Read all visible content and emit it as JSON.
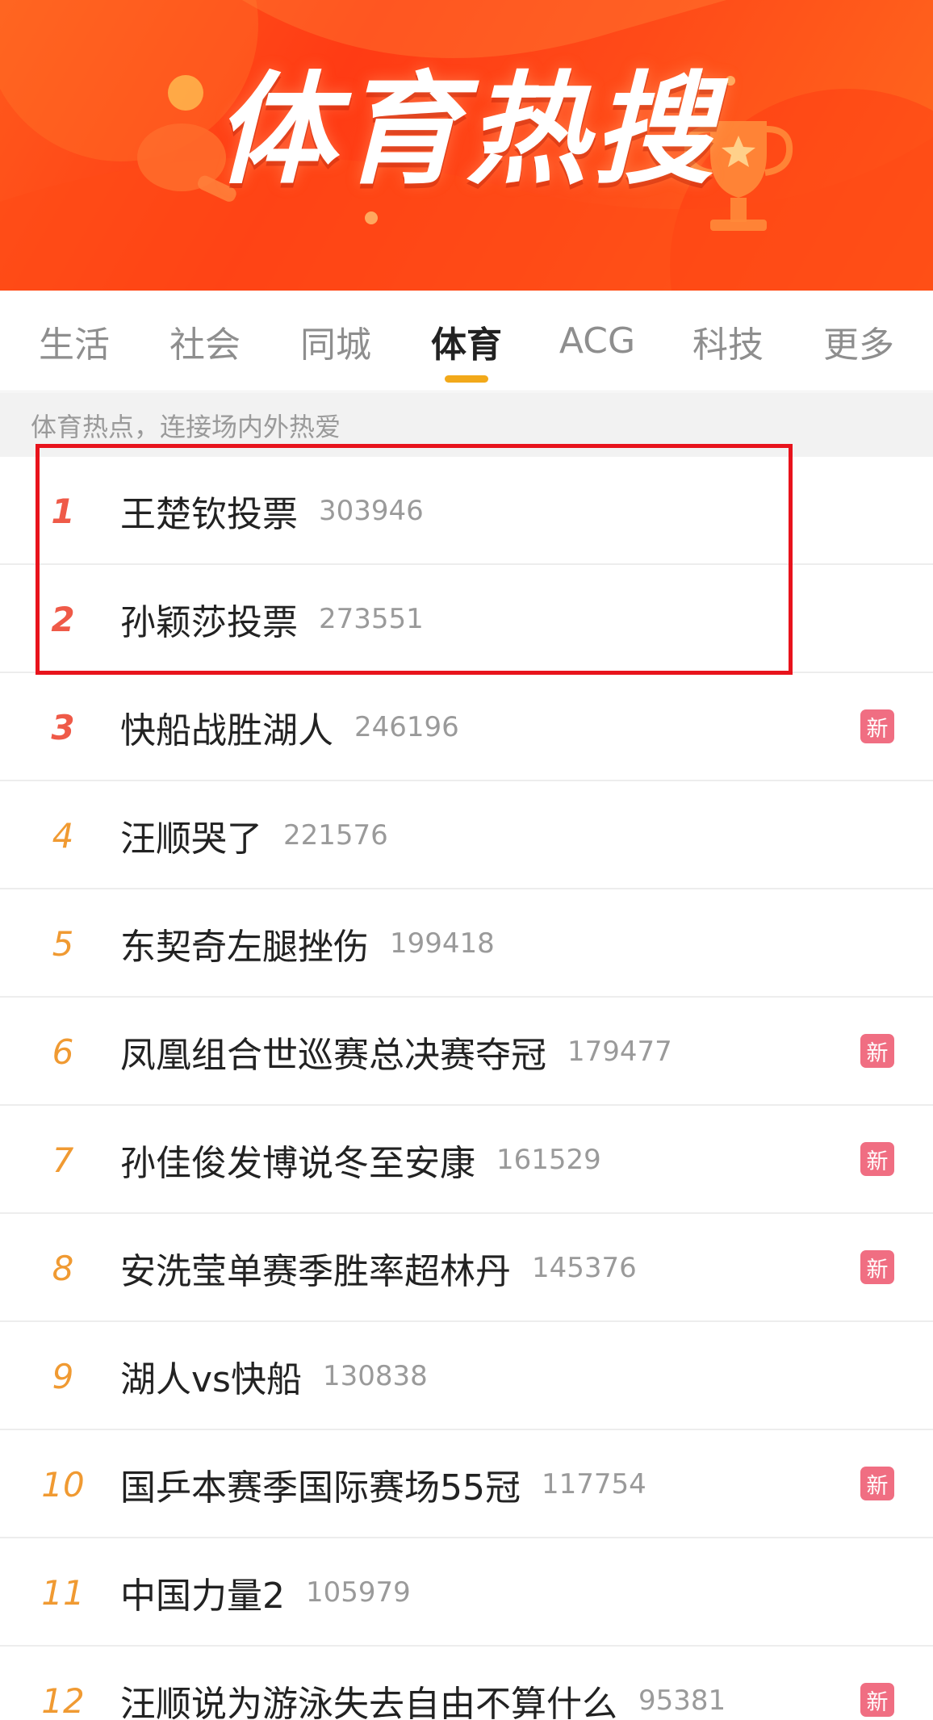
{
  "banner": {
    "title": "体育热搜"
  },
  "tabs": [
    {
      "label": "生活",
      "active": false
    },
    {
      "label": "社会",
      "active": false
    },
    {
      "label": "同城",
      "active": false
    },
    {
      "label": "体育",
      "active": true
    },
    {
      "label": "ACG",
      "active": false
    },
    {
      "label": "科技",
      "active": false
    },
    {
      "label": "更多",
      "active": false
    }
  ],
  "subtitle": "体育热点，连接场内外热爱",
  "items": [
    {
      "rank": "1",
      "title": "王楚钦投票",
      "count": "303946",
      "badge": ""
    },
    {
      "rank": "2",
      "title": "孙颖莎投票",
      "count": "273551",
      "badge": ""
    },
    {
      "rank": "3",
      "title": "快船战胜湖人",
      "count": "246196",
      "badge": "新"
    },
    {
      "rank": "4",
      "title": "汪顺哭了",
      "count": "221576",
      "badge": ""
    },
    {
      "rank": "5",
      "title": "东契奇左腿挫伤",
      "count": "199418",
      "badge": ""
    },
    {
      "rank": "6",
      "title": "凤凰组合世巡赛总决赛夺冠",
      "count": "179477",
      "badge": "新"
    },
    {
      "rank": "7",
      "title": "孙佳俊发博说冬至安康",
      "count": "161529",
      "badge": "新"
    },
    {
      "rank": "8",
      "title": "安洗莹单赛季胜率超林丹",
      "count": "145376",
      "badge": "新"
    },
    {
      "rank": "9",
      "title": "湖人vs快船",
      "count": "130838",
      "badge": ""
    },
    {
      "rank": "10",
      "title": "国乒本赛季国际赛场55冠",
      "count": "117754",
      "badge": "新"
    },
    {
      "rank": "11",
      "title": "中国力量2",
      "count": "105979",
      "badge": ""
    },
    {
      "rank": "12",
      "title": "汪顺说为游泳失去自由不算什么",
      "count": "95381",
      "badge": "新"
    }
  ],
  "colors": {
    "top_rank": "#ef5a48",
    "rank": "#f09a32",
    "active_tab_indicator": "#f2a91a",
    "badge": "#f06e82",
    "highlight_box": "#e8131c"
  }
}
